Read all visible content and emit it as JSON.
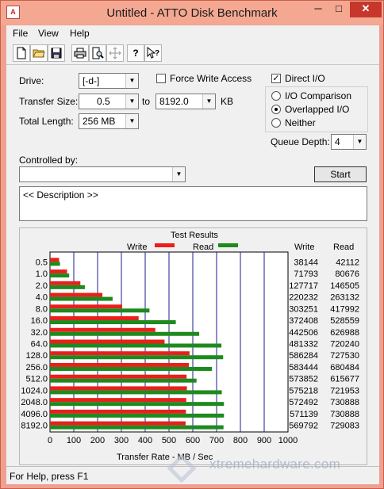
{
  "window": {
    "title": "Untitled - ATTO Disk Benchmark",
    "minimize_glyph": "─",
    "maximize_glyph": "□",
    "close_glyph": "✕",
    "app_icon": "atto-app-icon"
  },
  "menu": {
    "items": [
      {
        "label": "File"
      },
      {
        "label": "View"
      },
      {
        "label": "Help"
      }
    ]
  },
  "toolbar": {
    "buttons": [
      {
        "icon": "new-document-icon",
        "glyph": "🗋"
      },
      {
        "icon": "open-folder-icon",
        "glyph": "📂"
      },
      {
        "icon": "save-icon",
        "glyph": "💾"
      },
      {
        "icon": "print-icon",
        "glyph": "🖶"
      },
      {
        "icon": "print-preview-icon",
        "glyph": "🔍"
      },
      {
        "icon": "move-icon",
        "glyph": "✥"
      },
      {
        "icon": "help-icon",
        "glyph": "?"
      },
      {
        "icon": "context-help-icon",
        "glyph": "?"
      }
    ]
  },
  "settings": {
    "drive_label": "Drive:",
    "drive_value": "[-d-]",
    "transfer_size_label": "Transfer Size:",
    "transfer_from": "0.5",
    "to_label": "to",
    "transfer_to": "8192.0",
    "kb_label": "KB",
    "total_length_label": "Total Length:",
    "total_length_value": "256 MB",
    "force_write_label": "Force Write Access",
    "force_write_checked": false,
    "direct_io_label": "Direct I/O",
    "direct_io_checked": true,
    "io_options": [
      {
        "label": "I/O Comparison",
        "selected": false
      },
      {
        "label": "Overlapped I/O",
        "selected": true
      },
      {
        "label": "Neither",
        "selected": false
      }
    ],
    "queue_depth_label": "Queue Depth:",
    "queue_depth_value": "4",
    "controlled_by_label": "Controlled by:",
    "controlled_by_value": "",
    "start_label": "Start",
    "description": "<< Description >>"
  },
  "results": {
    "title": "Test Results",
    "write_legend": "Write",
    "read_legend": "Read",
    "write_col": "Write",
    "read_col": "Read",
    "write_color": "#e8201c",
    "read_color": "#1e8a1e",
    "rows": [
      {
        "size": "0.5",
        "write": "38144",
        "read": "42112"
      },
      {
        "size": "1.0",
        "write": "71793",
        "read": "80676"
      },
      {
        "size": "2.0",
        "write": "127717",
        "read": "146505"
      },
      {
        "size": "4.0",
        "write": "220232",
        "read": "263132"
      },
      {
        "size": "8.0",
        "write": "303251",
        "read": "417992"
      },
      {
        "size": "16.0",
        "write": "372408",
        "read": "528559"
      },
      {
        "size": "32.0",
        "write": "442506",
        "read": "626988"
      },
      {
        "size": "64.0",
        "write": "481332",
        "read": "720240"
      },
      {
        "size": "128.0",
        "write": "586284",
        "read": "727530"
      },
      {
        "size": "256.0",
        "write": "583444",
        "read": "680484"
      },
      {
        "size": "512.0",
        "write": "573852",
        "read": "615677"
      },
      {
        "size": "1024.0",
        "write": "575218",
        "read": "721953"
      },
      {
        "size": "2048.0",
        "write": "572492",
        "read": "730888"
      },
      {
        "size": "4096.0",
        "write": "571139",
        "read": "730888"
      },
      {
        "size": "8192.0",
        "write": "569792",
        "read": "729083"
      }
    ]
  },
  "chart_data": {
    "type": "bar",
    "orientation": "horizontal",
    "title": "Test Results",
    "xlabel": "Transfer Rate - MB / Sec",
    "categories": [
      "0.5",
      "1.0",
      "2.0",
      "4.0",
      "8.0",
      "16.0",
      "32.0",
      "64.0",
      "128.0",
      "256.0",
      "512.0",
      "1024.0",
      "2048.0",
      "4096.0",
      "8192.0"
    ],
    "series": [
      {
        "name": "Write",
        "values": [
          38.144,
          71.793,
          127.717,
          220.232,
          303.251,
          372.408,
          442.506,
          481.332,
          586.284,
          583.444,
          573.852,
          575.218,
          572.492,
          571.139,
          569.792
        ]
      },
      {
        "name": "Read",
        "values": [
          42.112,
          80.676,
          146.505,
          263.132,
          417.992,
          528.559,
          626.988,
          720.24,
          727.53,
          680.484,
          615.677,
          721.953,
          730.888,
          730.888,
          729.083
        ]
      }
    ],
    "xlim": [
      0,
      1000
    ],
    "xticks": [
      "0",
      "100",
      "200",
      "300",
      "400",
      "500",
      "600",
      "700",
      "800",
      "900",
      "1000"
    ],
    "grid": true
  },
  "status": {
    "text": "For Help, press F1"
  },
  "watermark": {
    "text": "xtremehardware.com"
  }
}
